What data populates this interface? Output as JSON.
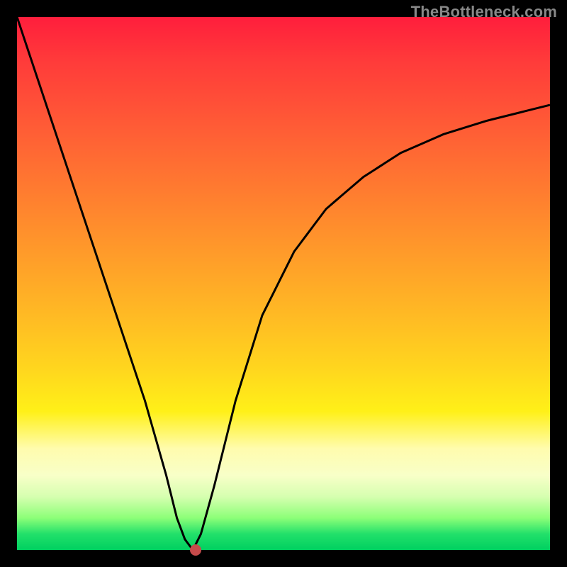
{
  "watermark": "TheBottleneck.com",
  "colors": {
    "curve": "#000000",
    "marker": "#c64b4b",
    "frame_bg": "#000000"
  },
  "chart_data": {
    "type": "line",
    "title": "",
    "xlabel": "",
    "ylabel": "",
    "xlim": [
      0,
      100
    ],
    "ylim": [
      0,
      100
    ],
    "grid": false,
    "legend": false,
    "description": "V-shaped bottleneck curve on a heat-gradient background (red high, green low). Minimum of the curve sits near x≈33 at y≈0.",
    "series": [
      {
        "name": "bottleneck-curve",
        "x": [
          0,
          4,
          8,
          12,
          16,
          20,
          24,
          28,
          30,
          31.5,
          33,
          34.5,
          37,
          41,
          46,
          52,
          58,
          65,
          72,
          80,
          88,
          96,
          100
        ],
        "y": [
          100,
          88,
          76,
          64,
          52,
          40,
          28,
          14,
          6,
          2,
          0,
          3,
          12,
          28,
          44,
          56,
          64,
          70,
          74.5,
          78,
          80.5,
          82.5,
          83.5
        ]
      }
    ],
    "marker": {
      "x": 33.5,
      "y": 0
    }
  }
}
